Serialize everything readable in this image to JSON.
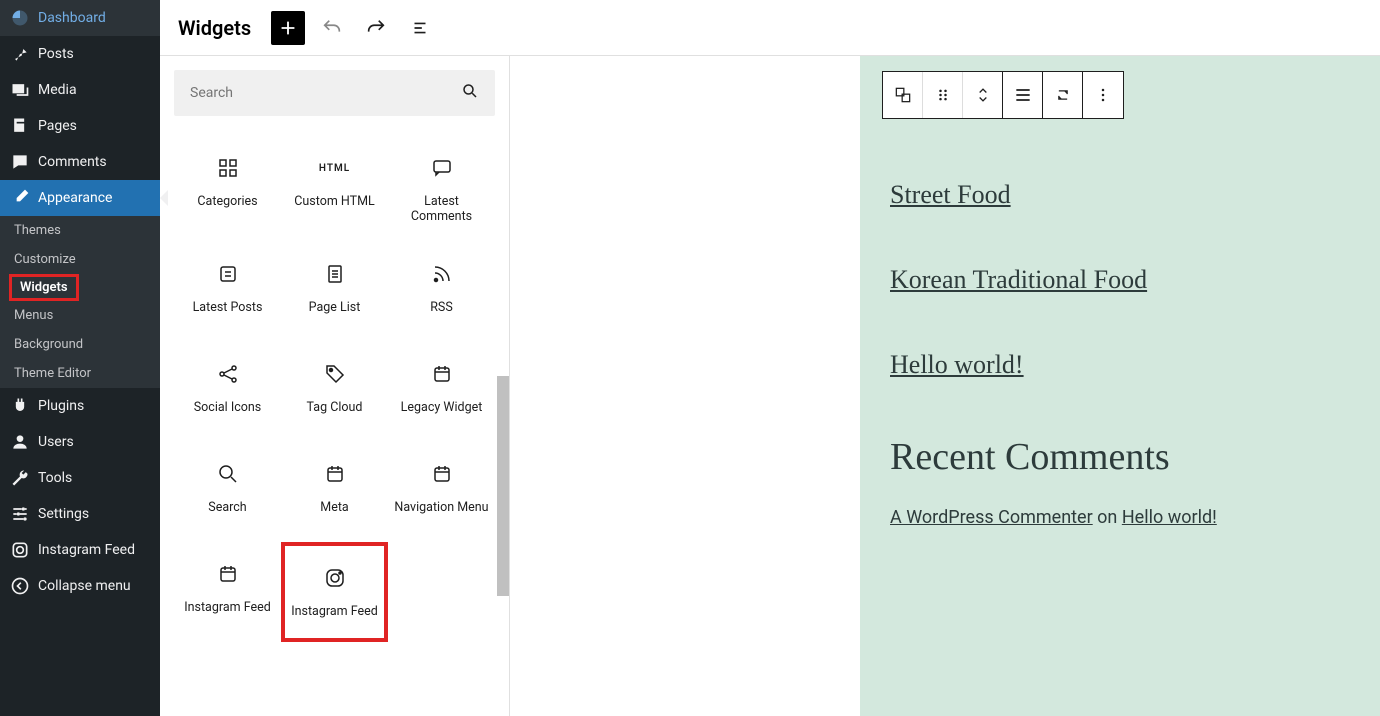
{
  "sidebar": {
    "items": [
      {
        "label": "Dashboard",
        "icon": "dashboard"
      },
      {
        "label": "Posts",
        "icon": "pin"
      },
      {
        "label": "Media",
        "icon": "media"
      },
      {
        "label": "Pages",
        "icon": "page"
      },
      {
        "label": "Comments",
        "icon": "comment"
      },
      {
        "label": "Appearance",
        "icon": "brush",
        "active": true
      },
      {
        "label": "Plugins",
        "icon": "plug"
      },
      {
        "label": "Users",
        "icon": "user"
      },
      {
        "label": "Tools",
        "icon": "wrench"
      },
      {
        "label": "Settings",
        "icon": "sliders"
      },
      {
        "label": "Instagram Feed",
        "icon": "instagram"
      },
      {
        "label": "Collapse menu",
        "icon": "collapse"
      }
    ],
    "submenu": [
      {
        "label": "Themes"
      },
      {
        "label": "Customize"
      },
      {
        "label": "Widgets",
        "current": true
      },
      {
        "label": "Menus"
      },
      {
        "label": "Background"
      },
      {
        "label": "Theme Editor"
      }
    ]
  },
  "topbar": {
    "title": "Widgets"
  },
  "inserter": {
    "search_placeholder": "Search",
    "blocks": [
      {
        "label": "Categories",
        "icon": "categories"
      },
      {
        "label": "Custom HTML",
        "icon": "html"
      },
      {
        "label": "Latest Comments",
        "icon": "latest-comments"
      },
      {
        "label": "Latest Posts",
        "icon": "latest-posts"
      },
      {
        "label": "Page List",
        "icon": "page-list"
      },
      {
        "label": "RSS",
        "icon": "rss"
      },
      {
        "label": "Social Icons",
        "icon": "share"
      },
      {
        "label": "Tag Cloud",
        "icon": "tag"
      },
      {
        "label": "Legacy Widget",
        "icon": "calendar"
      },
      {
        "label": "Search",
        "icon": "search"
      },
      {
        "label": "Meta",
        "icon": "calendar"
      },
      {
        "label": "Navigation Menu",
        "icon": "calendar"
      },
      {
        "label": "Instagram Feed",
        "icon": "calendar"
      },
      {
        "label": "Instagram Feed",
        "icon": "instagram-o",
        "highlight": true
      }
    ]
  },
  "preview": {
    "links": [
      "Street Food",
      "Korean Traditional Food",
      "Hello world!"
    ],
    "heading": "Recent Comments",
    "comment_author": "A WordPress Commenter",
    "comment_on": " on ",
    "comment_post": "Hello world!"
  }
}
